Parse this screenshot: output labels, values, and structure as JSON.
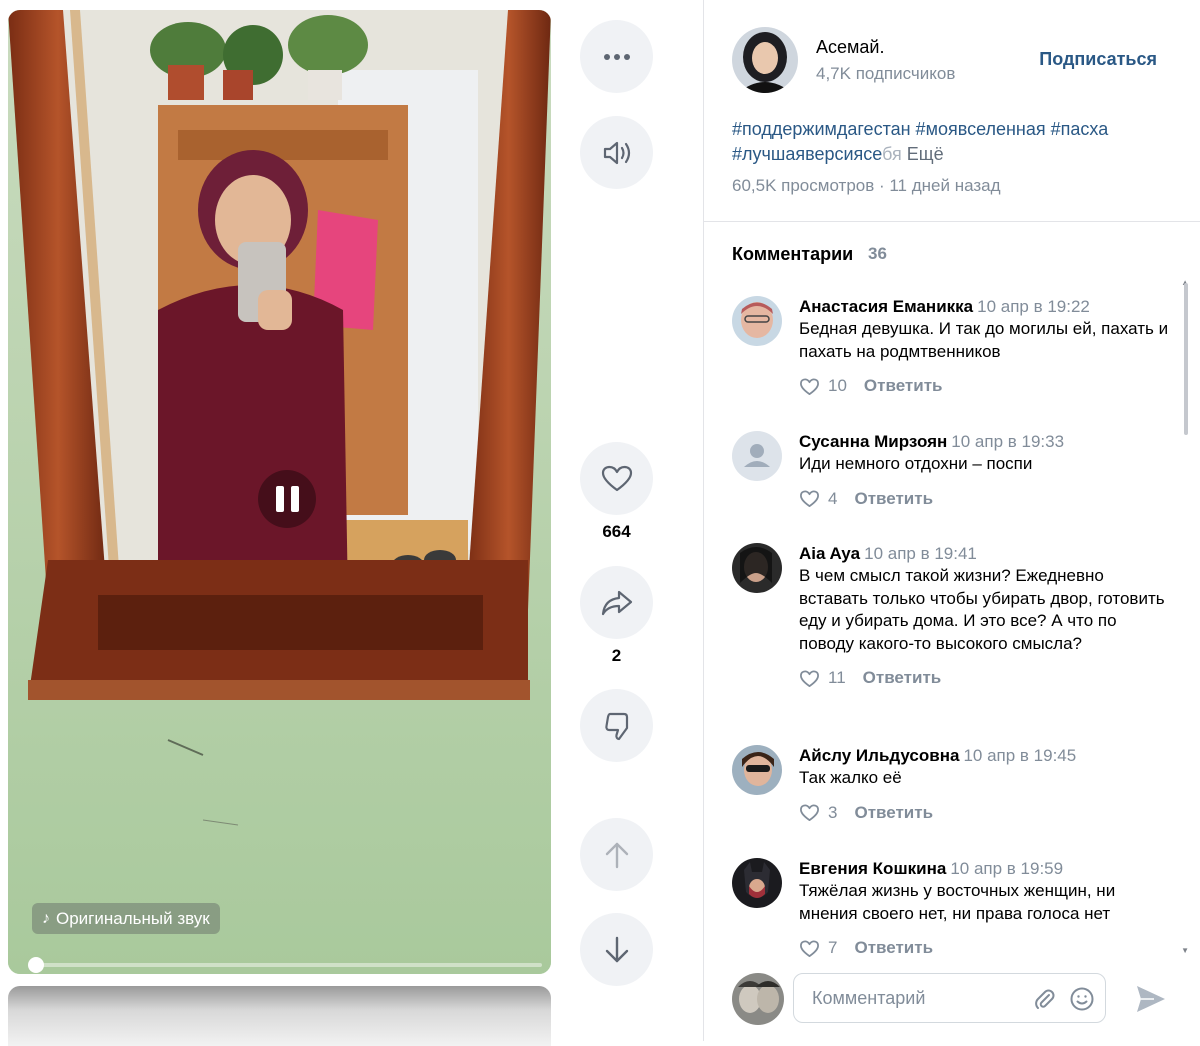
{
  "video": {
    "sound_label": "Оригинальный звук",
    "progress": 0.0
  },
  "actions": {
    "likes": "664",
    "shares": "2"
  },
  "author": {
    "name": "Асемай.",
    "subscribers": "4,7K подписчиков",
    "subscribe_label": "Подписаться"
  },
  "description": {
    "hashtags_line1": "#поддержимдагестан #моявселенная #пасха",
    "hashtags_line2": "#лучшаяверсиясе",
    "hashtags_faded": "бя",
    "more_label": "Ещё",
    "meta": "60,5K просмотров · 11 дней назад"
  },
  "comments": {
    "title": "Комментарии",
    "count": "36",
    "reply_label": "Ответить",
    "items": [
      {
        "author": "Анастасия Еманикка",
        "date": "10 апр в 19:22",
        "text": "Бедная девушка. И так до могилы ей, пахать и пахать на родмтвенников",
        "likes": "10"
      },
      {
        "author": "Сусанна Мирзоян",
        "date": "10 апр в 19:33",
        "text": "Иди немного отдохни – поспи",
        "likes": "4"
      },
      {
        "author": "Aia Aya",
        "date": "10 апр в 19:41",
        "text": "В чем смысл такой жизни? Ежедневно вставать только чтобы убирать двор, готовить еду и убирать дома. И это все? А что по поводу какого-то высокого смысла?",
        "likes": "11"
      },
      {
        "author": "Айслу Ильдусовна",
        "date": "10 апр в 19:45",
        "text": "Так жалко её",
        "likes": "3"
      },
      {
        "author": "Евгения Кошкина",
        "date": "10 апр в 19:59",
        "text": "Тяжёлая жизнь у восточных женщин, ни мнения своего нет, ни права голоса нет",
        "likes": "7"
      }
    ]
  },
  "composer": {
    "placeholder": "Комментарий"
  },
  "colors": {
    "link": "#2a5885",
    "secondary": "#818c99",
    "button_bg": "#f0f2f5"
  }
}
